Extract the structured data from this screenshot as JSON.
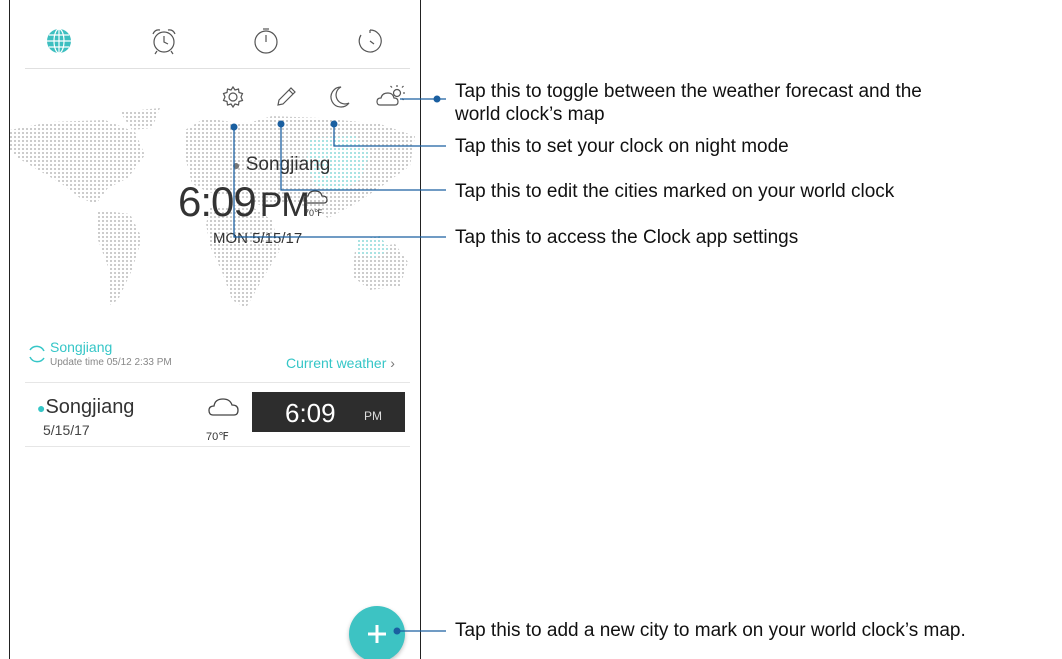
{
  "tabs": {
    "world_clock": "globe-icon",
    "alarm": "alarm-clock-icon",
    "stopwatch": "stopwatch-icon",
    "timer": "timer-icon"
  },
  "map": {
    "city": "Songjiang",
    "time": "6:09",
    "ampm": "PM",
    "temp": "70℉",
    "date": "MON 5/15/17"
  },
  "weather": {
    "city": "Songjiang",
    "update": "Update time 05/12 2:33 PM",
    "link": "Current weather"
  },
  "city_row": {
    "name": "Songjiang",
    "date": "5/15/17",
    "temp": "70℉",
    "time": "6:09",
    "ampm": "PM"
  },
  "callouts": {
    "toggle_line1": "Tap this to toggle between the weather forecast and the",
    "toggle_line2": "world clock’s map",
    "night": "Tap this to set your clock on night mode",
    "edit": "Tap this to edit the cities marked on your world clock",
    "settings": "Tap this to access the Clock app settings",
    "add": "Tap this to add a new city to mark on your world clock’s map."
  },
  "colors": {
    "accent": "#35c6c7",
    "callout_line": "#1a5fa0",
    "dark_tile": "#2d2d2d"
  }
}
